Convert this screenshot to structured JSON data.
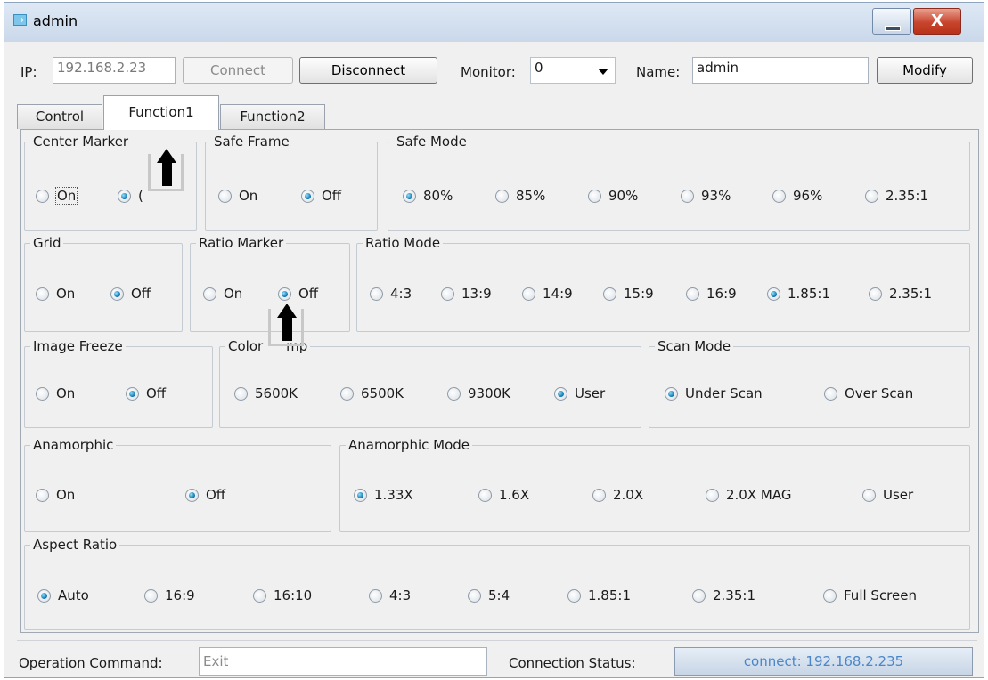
{
  "window": {
    "title": "admin",
    "close_glyph": "X"
  },
  "toolbar": {
    "ip_label": "IP:",
    "ip_value": "192.168.2.23",
    "connect_label": "Connect",
    "disconnect_label": "Disconnect",
    "monitor_label": "Monitor:",
    "monitor_value": "0",
    "name_label": "Name:",
    "name_value": "admin",
    "modify_label": "Modify"
  },
  "tabs": [
    {
      "label": "Control",
      "active": false
    },
    {
      "label": "Function1",
      "active": true
    },
    {
      "label": "Function2",
      "active": false
    }
  ],
  "groups": {
    "center_marker": {
      "title": "Center Marker",
      "options": [
        "On",
        "Off"
      ],
      "visible_options": [
        "On",
        "("
      ],
      "selected": "Off"
    },
    "safe_frame": {
      "title": "Safe Frame",
      "options": [
        "On",
        "Off"
      ],
      "selected": "Off"
    },
    "safe_mode": {
      "title": "Safe Mode",
      "options": [
        "80%",
        "85%",
        "90%",
        "93%",
        "96%",
        "2.35:1"
      ],
      "selected": "80%"
    },
    "grid": {
      "title": "Grid",
      "options": [
        "On",
        "Off"
      ],
      "selected": "Off"
    },
    "ratio_marker": {
      "title": "Ratio Marker",
      "options": [
        "On",
        "Off"
      ],
      "selected": "Off"
    },
    "ratio_mode": {
      "title": "Ratio Mode",
      "options": [
        "4:3",
        "13:9",
        "14:9",
        "15:9",
        "16:9",
        "1.85:1",
        "2.35:1"
      ],
      "selected": "1.85:1"
    },
    "image_freeze": {
      "title": "Image Freeze",
      "options": [
        "On",
        "Off"
      ],
      "selected": "Off"
    },
    "color_temp": {
      "title": "Color",
      "title_tail": "mp",
      "options": [
        "5600K",
        "6500K",
        "9300K",
        "User"
      ],
      "selected": "User"
    },
    "scan_mode": {
      "title": "Scan Mode",
      "options": [
        "Under Scan",
        "Over Scan"
      ],
      "selected": "Under Scan"
    },
    "anamorphic": {
      "title": "Anamorphic",
      "options": [
        "On",
        "Off"
      ],
      "selected": "Off"
    },
    "anamorphic_mode": {
      "title": "Anamorphic Mode",
      "options": [
        "1.33X",
        "1.6X",
        "2.0X",
        "2.0X MAG",
        "User"
      ],
      "selected": "1.33X"
    },
    "aspect_ratio": {
      "title": "Aspect Ratio",
      "options": [
        "Auto",
        "16:9",
        "16:10",
        "4:3",
        "5:4",
        "1.85:1",
        "2.35:1",
        "Full Screen"
      ],
      "selected": "Auto"
    }
  },
  "statusbar": {
    "operation_label": "Operation Command:",
    "operation_value": "Exit",
    "connection_label": "Connection Status:",
    "connection_value": "connect: 192.168.2.235"
  },
  "colors": {
    "accent": "#0a6fa8",
    "status_text": "#4a86c8",
    "close_red": "#c8452d"
  },
  "annotations": [
    "up-arrow",
    "up-arrow"
  ]
}
